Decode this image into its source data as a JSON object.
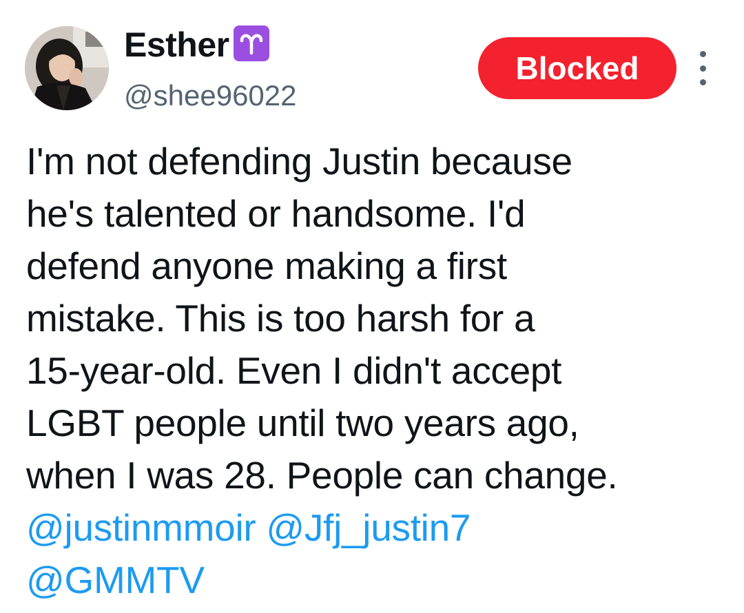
{
  "author": {
    "display_name": "Esther",
    "zodiac_badge": "aries-icon",
    "handle": "@shee96022",
    "avatar": "profile-photo"
  },
  "actions": {
    "blocked_label": "Blocked",
    "more_icon": "more-vertical-icon"
  },
  "tweet": {
    "lines": [
      "I'm not defending Justin because",
      "he's talented or handsome. I'd",
      "defend anyone making a first",
      "mistake. This is too harsh for a",
      "15-year-old. Even I didn't accept",
      "LGBT people until two years ago,",
      "when I was 28. People can change."
    ],
    "mentions": [
      "@justinmmoir",
      "@Jfj_justin7",
      "@GMMTV"
    ]
  },
  "colors": {
    "text": "#0f1419",
    "secondary": "#536471",
    "mention": "#1d9bf0",
    "blocked_bg": "#f4212e",
    "badge_bg": "#9b4fe0"
  }
}
